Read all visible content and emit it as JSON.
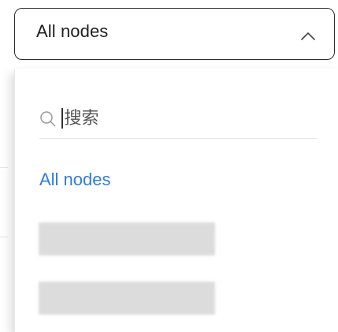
{
  "select": {
    "value": "All nodes",
    "expanded": true
  },
  "dropdown": {
    "search_placeholder": "搜索",
    "options": [
      {
        "label": "All nodes",
        "selected": true
      },
      {
        "label": "",
        "redacted": true
      },
      {
        "label": "",
        "redacted": true
      }
    ]
  },
  "colors": {
    "selected_option": "#2f7de1",
    "border": "#2b2b2b",
    "divider": "#e6e6e6",
    "redacted_fill": "#dcdcdc"
  },
  "icons": {
    "trigger": "chevron-up-icon",
    "search": "search-icon"
  }
}
